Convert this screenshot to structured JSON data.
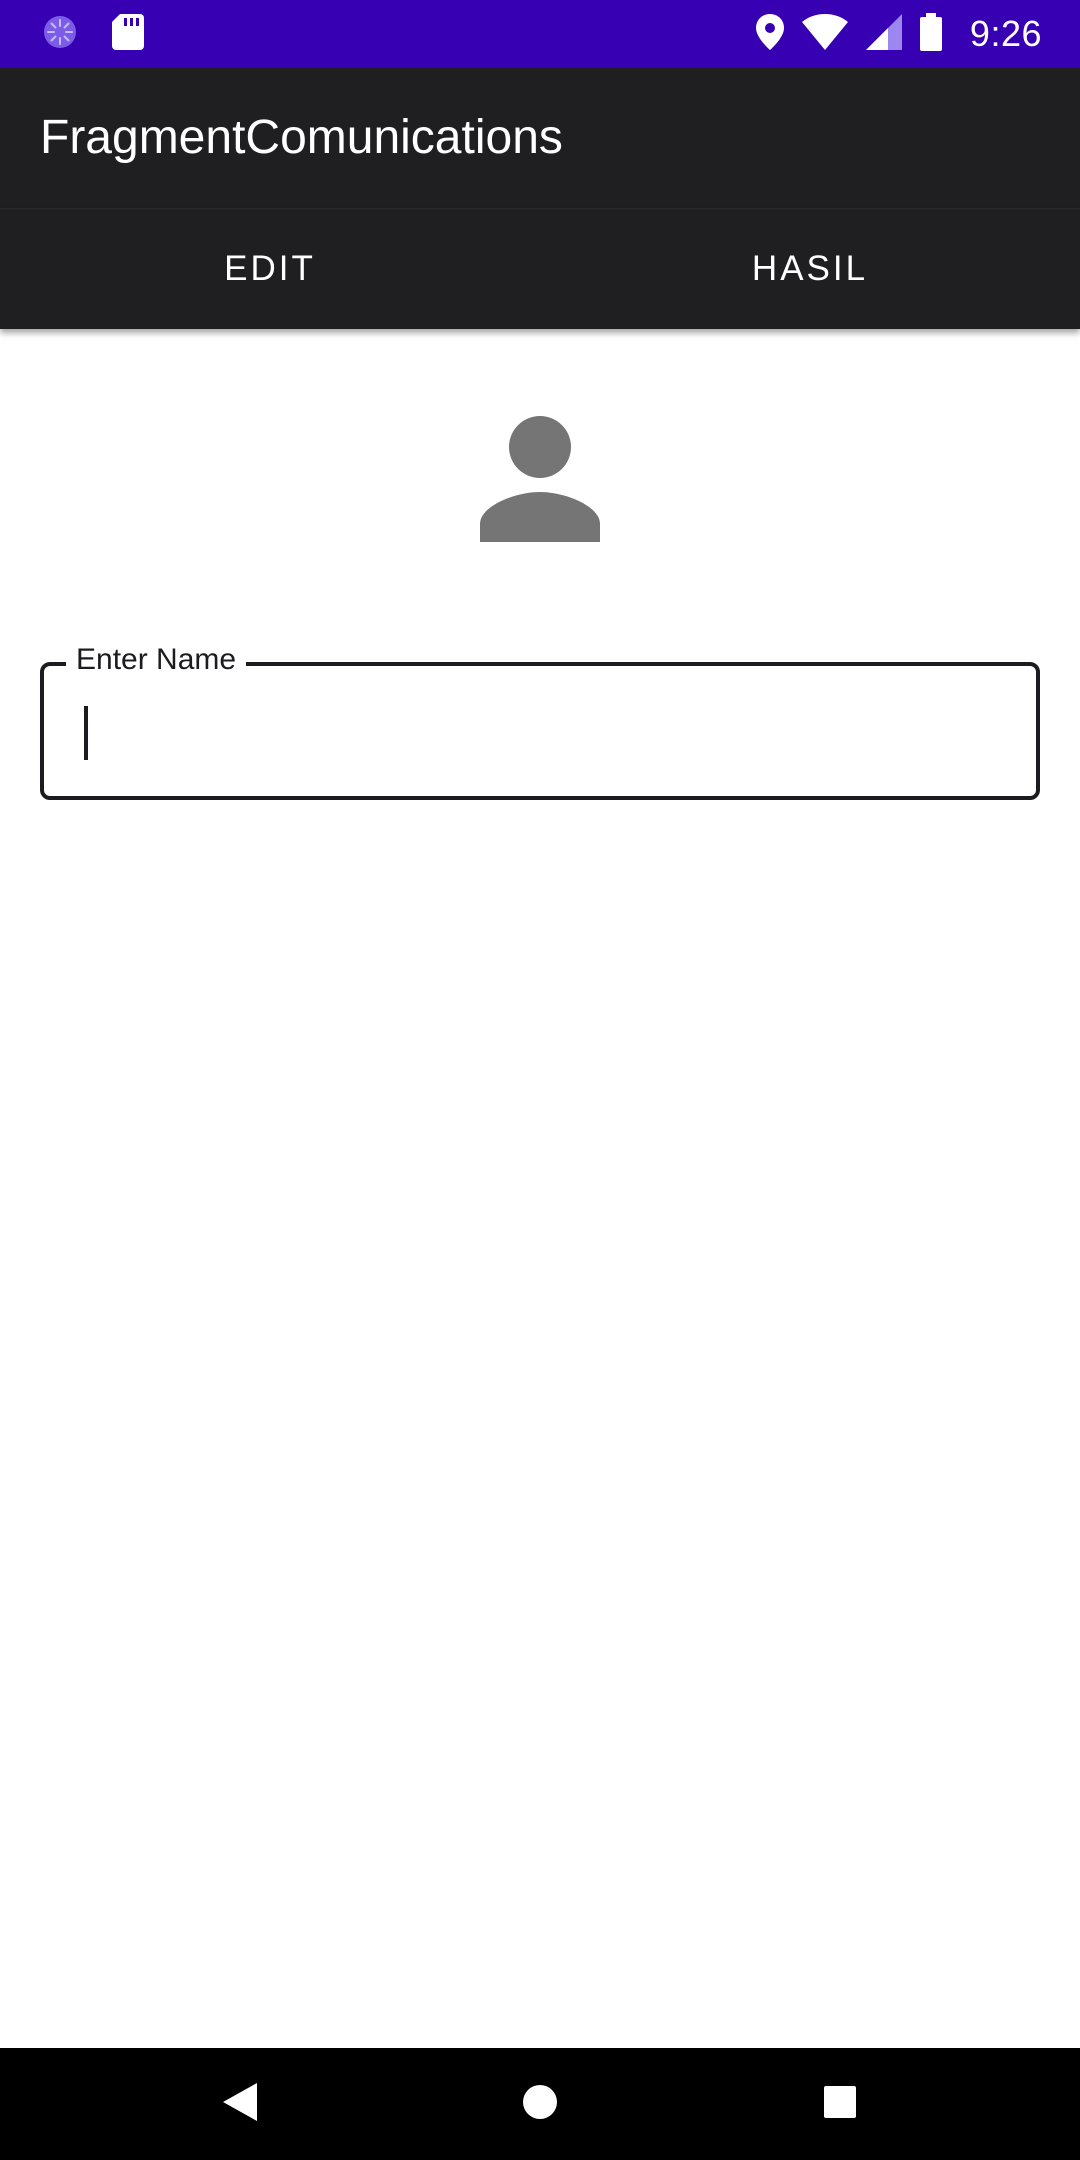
{
  "status_bar": {
    "time": "9:26",
    "icons": [
      "sync-icon",
      "sd-card-icon",
      "location-icon",
      "wifi-icon",
      "signal-icon",
      "battery-icon"
    ],
    "background": "#3700b3"
  },
  "app_bar": {
    "title": "FragmentComunications",
    "background": "#1f1f21"
  },
  "tabs": [
    {
      "label": "EDIT"
    },
    {
      "label": "HASIL"
    }
  ],
  "content": {
    "avatar_icon": "person-icon",
    "name_field": {
      "label": "Enter Name",
      "value": ""
    }
  },
  "nav_bar": {
    "buttons": [
      "back-icon",
      "home-icon",
      "recents-icon"
    ]
  }
}
